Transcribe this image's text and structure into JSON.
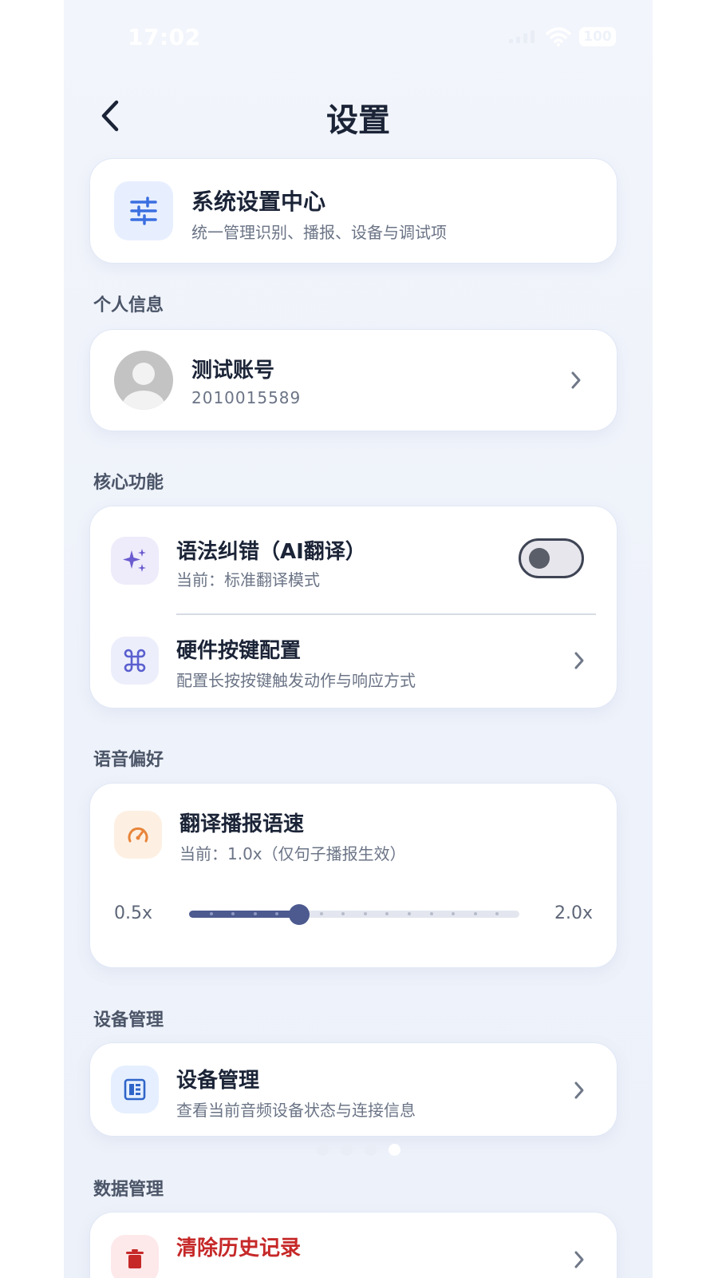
{
  "status_bar": {
    "time": "17:02",
    "battery": "100"
  },
  "header": {
    "title": "设置"
  },
  "summary_card": {
    "title": "系统设置中心",
    "subtitle": "统一管理识别、播报、设备与调试项"
  },
  "sections": {
    "personal": "个人信息",
    "core": "核心功能",
    "voice": "语音偏好",
    "device": "设备管理",
    "data": "数据管理"
  },
  "account": {
    "name": "测试账号",
    "id": "2010015589"
  },
  "grammar": {
    "title": "语法纠错（AI翻译）",
    "subtitle": "当前：标准翻译模式",
    "enabled": false
  },
  "hardware": {
    "title": "硬件按键配置",
    "subtitle": "配置长按按键触发动作与响应方式"
  },
  "speed": {
    "title": "翻译播报语速",
    "subtitle": "当前：1.0x（仅句子播报生效）",
    "min_label": "0.5x",
    "max_label": "2.0x",
    "min": 0.5,
    "max": 2.0,
    "value": 1.0,
    "step": 0.1
  },
  "device": {
    "title": "设备管理",
    "subtitle": "查看当前音频设备状态与连接信息"
  },
  "clear_history": {
    "title": "清除历史记录"
  },
  "pager": {
    "count": 4,
    "active": 3
  },
  "colors": {
    "title_text": "#1b2437",
    "sub_text": "#6b7486",
    "accent_slider": "#4c5a8f",
    "danger": "#c62828",
    "speed_icon": "#e8843a",
    "sparkle_icon": "#6a5bd0"
  },
  "icons": {
    "summary": "sliders-icon",
    "avatar": "person-placeholder-icon",
    "grammar": "sparkle-icon",
    "hardware": "command-key-icon",
    "speed": "gauge-icon",
    "device": "device-panel-icon",
    "clear": "trash-icon"
  }
}
